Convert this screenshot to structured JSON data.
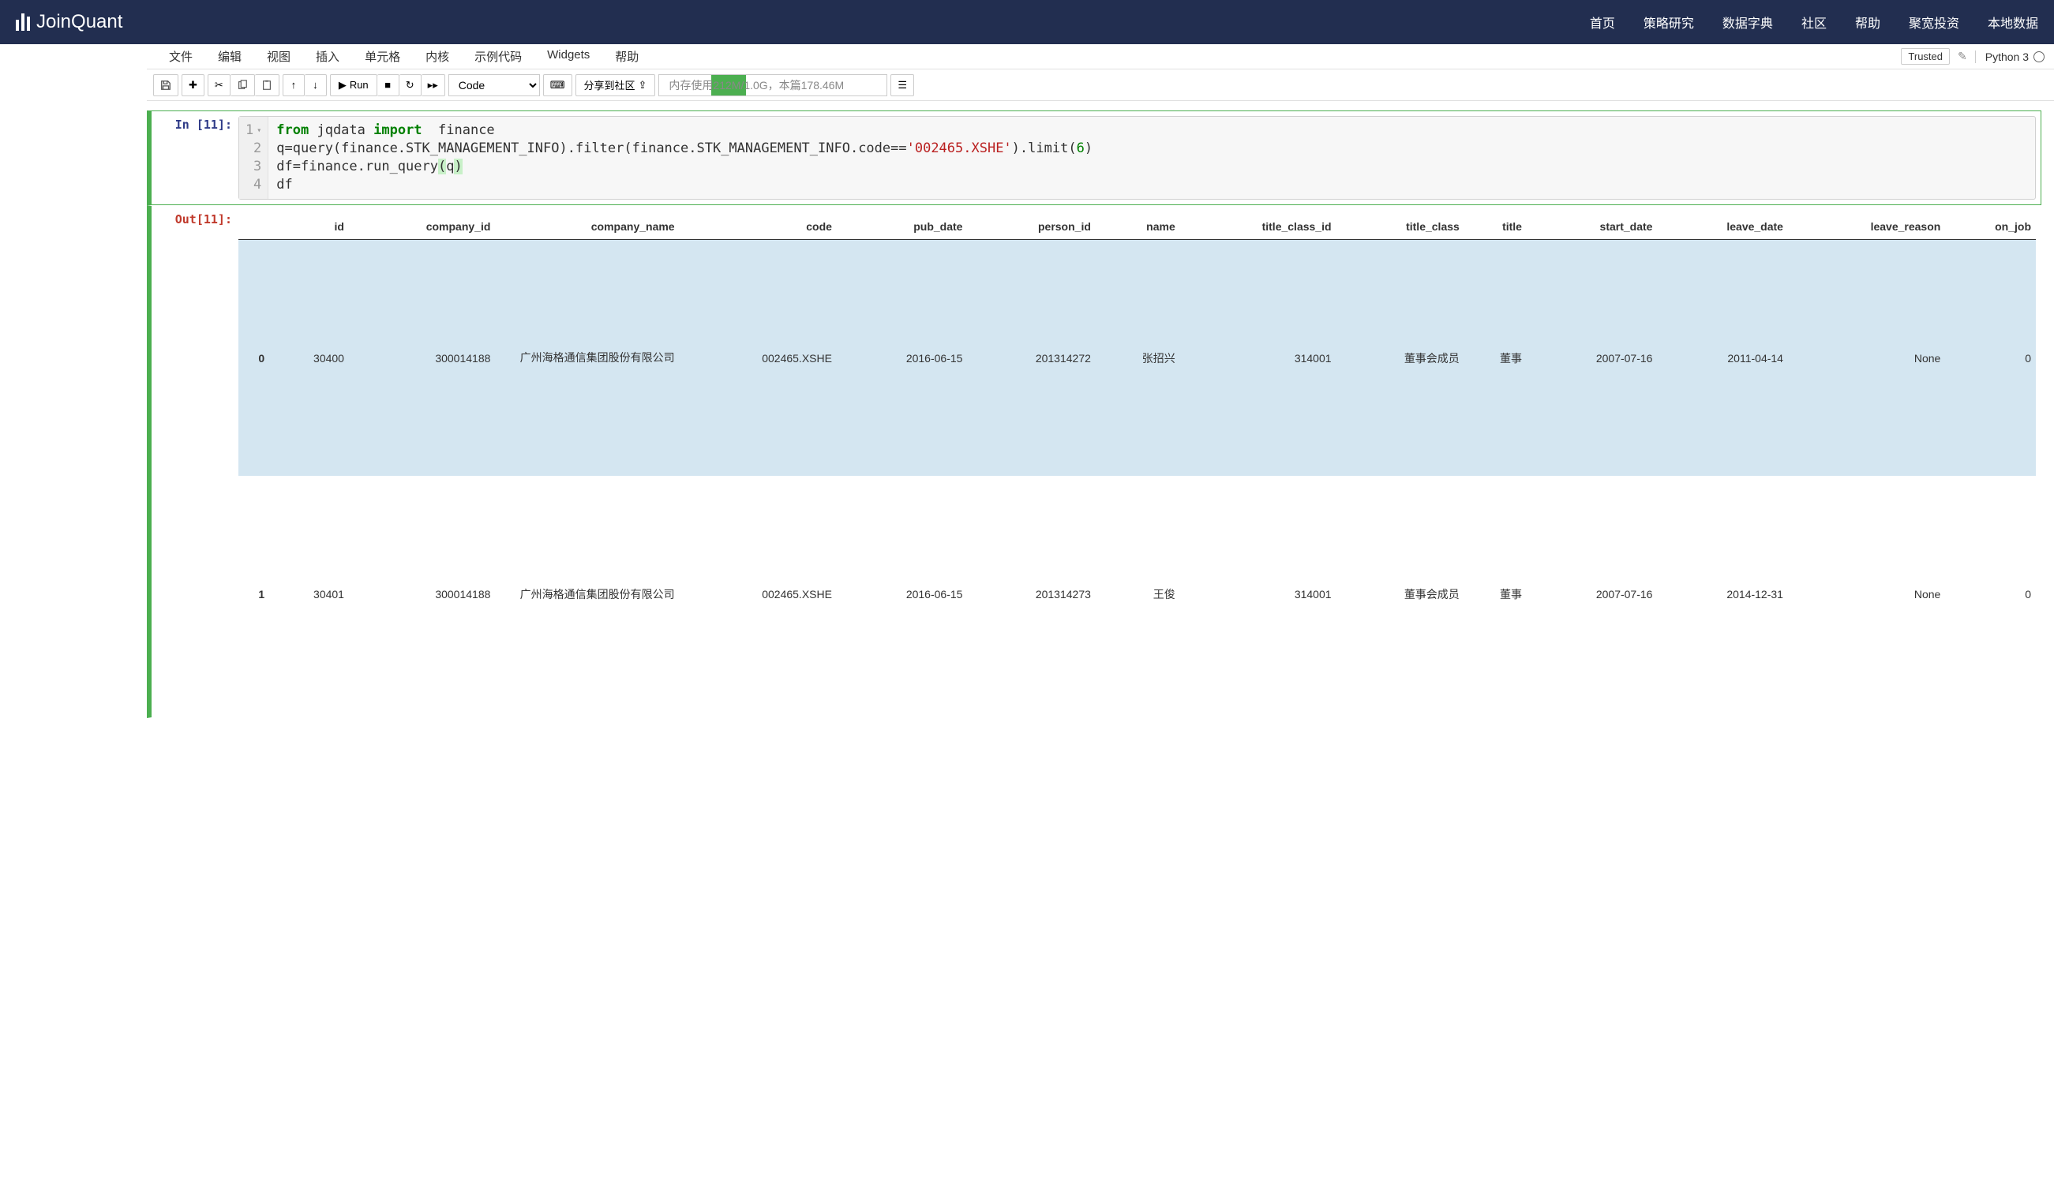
{
  "brand": "JoinQuant",
  "nav": [
    "首页",
    "策略研究",
    "数据字典",
    "社区",
    "帮助",
    "聚宽投资",
    "本地数据"
  ],
  "menubar": [
    "文件",
    "编辑",
    "视图",
    "插入",
    "单元格",
    "内核",
    "示例代码",
    "Widgets",
    "帮助"
  ],
  "trusted": "Trusted",
  "kernel": "Python 3",
  "toolbar": {
    "run": "Run",
    "celltype": "Code",
    "share": "分享到社区",
    "mem_label": "内存使用",
    "mem_value": "212M/1.0G，本篇178.46M"
  },
  "cell": {
    "in_prompt": "In [11]:",
    "out_prompt": "Out[11]:",
    "lines": [
      "1",
      "2",
      "3",
      "4"
    ],
    "code_tokens": {
      "l1_from": "from",
      "l1_mod": " jqdata ",
      "l1_import": "import",
      "l1_rest": "  finance",
      "l2": "q=query(finance.STK_MANAGEMENT_INFO).filter(finance.STK_MANAGEMENT_INFO.code==",
      "l2_str": "'002465.XSHE'",
      "l2_b": ").limit(",
      "l2_num": "6",
      "l2_c": ")",
      "l3a": "df=finance.run_query",
      "l3p1": "(",
      "l3v": "q",
      "l3p2": ")",
      "l4": "df"
    }
  },
  "table": {
    "headers": [
      "",
      "id",
      "company_id",
      "company_name",
      "code",
      "pub_date",
      "person_id",
      "name",
      "title_class_id",
      "title_class",
      "title",
      "start_date",
      "leave_date",
      "leave_reason",
      "on_job"
    ],
    "rows": [
      {
        "idx": "0",
        "id": "30400",
        "company_id": "300014188",
        "company_name": "广州海格通信集团股份有限公司",
        "code": "002465.XSHE",
        "pub_date": "2016-06-15",
        "person_id": "201314272",
        "name": "张招兴",
        "title_class_id": "314001",
        "title_class": "董事会成员",
        "title": "董事",
        "start_date": "2007-07-16",
        "leave_date": "2011-04-14",
        "leave_reason": "None",
        "on_job": "0"
      },
      {
        "idx": "1",
        "id": "30401",
        "company_id": "300014188",
        "company_name": "广州海格通信集团股份有限公司",
        "code": "002465.XSHE",
        "pub_date": "2016-06-15",
        "person_id": "201314273",
        "name": "王俊",
        "title_class_id": "314001",
        "title_class": "董事会成员",
        "title": "董事",
        "start_date": "2007-07-16",
        "leave_date": "2014-12-31",
        "leave_reason": "None",
        "on_job": "0"
      }
    ]
  }
}
